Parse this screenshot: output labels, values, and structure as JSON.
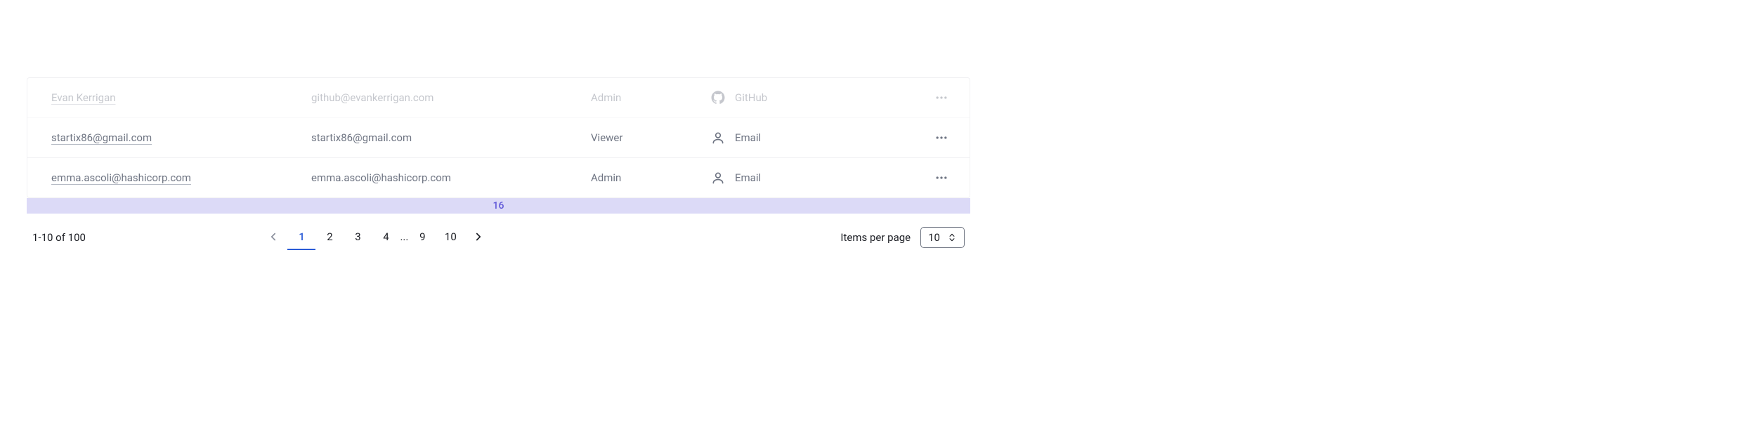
{
  "rows": [
    {
      "name": "Evan Kerrigan",
      "email": "github@evankerrigan.com",
      "role": "Admin",
      "auth": "GitHub",
      "auth_icon": "github",
      "faded": true
    },
    {
      "name": "startix86@gmail.com",
      "email": "startix86@gmail.com",
      "role": "Viewer",
      "auth": "Email",
      "auth_icon": "user",
      "faded": false
    },
    {
      "name": "emma.ascoli@hashicorp.com",
      "email": "emma.ascoli@hashicorp.com",
      "role": "Admin",
      "auth": "Email",
      "auth_icon": "user",
      "faded": false
    }
  ],
  "badge": "16",
  "pagination": {
    "range": "1-10 of 100",
    "pages": [
      "1",
      "2",
      "3",
      "4",
      "...",
      "9",
      "10"
    ],
    "active_index": 0,
    "items_per_page_label": "Items per page",
    "items_per_page_value": "10"
  }
}
